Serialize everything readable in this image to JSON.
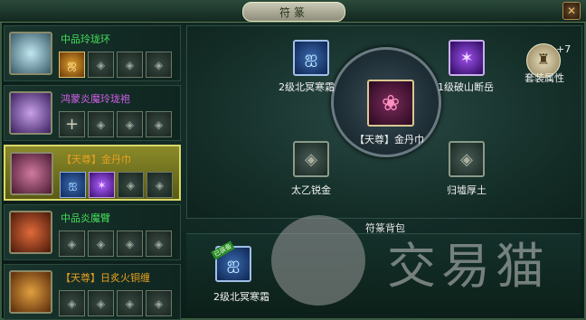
{
  "window": {
    "title": "符篆",
    "close_label": "✕"
  },
  "items": [
    {
      "name": "中品玲珑环",
      "name_color": "#46e05a",
      "icon": "ring-icon",
      "slots": [
        "gold-rune",
        "empty",
        "empty",
        "empty"
      ]
    },
    {
      "name": "鸿蒙炎魔玲珑袍",
      "name_color": "#d060e8",
      "icon": "robe-icon",
      "slots": [
        "plus",
        "empty",
        "empty",
        "empty"
      ]
    },
    {
      "name": "【天尊】金丹巾",
      "name_color": "#e8a020",
      "icon": "headband-icon",
      "selected": true,
      "slots": [
        "blue-rune",
        "purple-rune",
        "empty",
        "empty"
      ]
    },
    {
      "name": "中品炎魔臂",
      "name_color": "#46e05a",
      "icon": "bracer-icon",
      "slots": [
        "empty",
        "empty",
        "empty",
        "empty"
      ]
    },
    {
      "name": "【天尊】日炙火铜缠",
      "name_color": "#e8a020",
      "icon": "wrap-icon",
      "slots": [
        "empty",
        "empty",
        "empty",
        "empty"
      ]
    }
  ],
  "wheel": {
    "center_label": "【天尊】金丹巾",
    "top_left_label": "2级北冥寒霜",
    "top_right_label": "1级破山断岳",
    "bottom_left_label": "太乙锐金",
    "bottom_right_label": "归墟厚土"
  },
  "set_attribute": {
    "label": "套装属性",
    "count": "+7"
  },
  "bag": {
    "title": "符篆背包",
    "items": [
      {
        "label": "2级北冥寒霜",
        "tag": "已装备"
      }
    ]
  },
  "watermark": {
    "text": "交易猫"
  },
  "colors": {
    "selected_row": "#8a8a2a",
    "green_quality": "#46e05a",
    "purple_quality": "#d060e8",
    "gold_quality": "#e8a020"
  }
}
